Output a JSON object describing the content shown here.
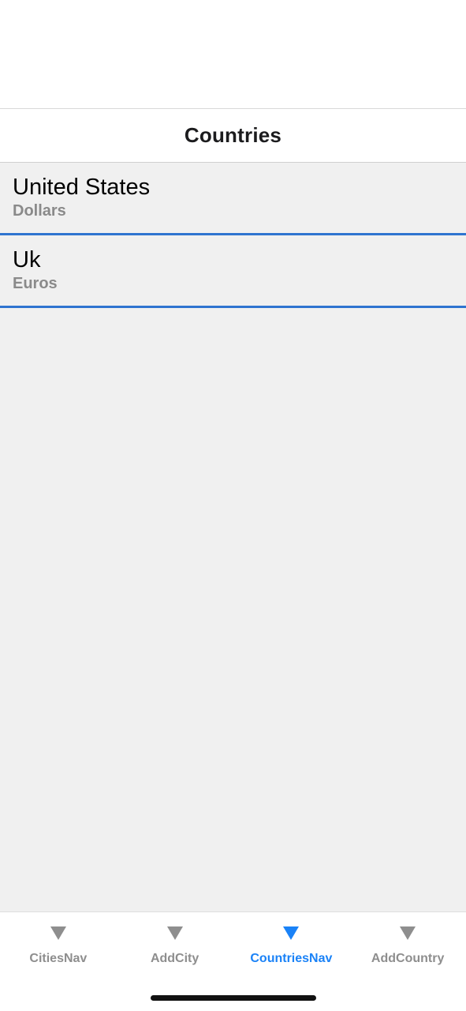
{
  "header": {
    "title": "Countries"
  },
  "countries": [
    {
      "name": "United States",
      "currency": "Dollars"
    },
    {
      "name": "Uk",
      "currency": "Euros"
    }
  ],
  "tabbar": {
    "tabs": [
      {
        "label": "CitiesNav",
        "icon": "triangle-down-icon",
        "active": false
      },
      {
        "label": "AddCity",
        "icon": "triangle-down-icon",
        "active": false
      },
      {
        "label": "CountriesNav",
        "icon": "triangle-down-icon",
        "active": true
      },
      {
        "label": "AddCountry",
        "icon": "triangle-down-icon",
        "active": false
      }
    ],
    "active_color": "#1a82f7",
    "inactive_color": "#8e8e8e"
  },
  "colors": {
    "list_divider": "#2f74d0",
    "list_background": "#f0f0f0"
  }
}
